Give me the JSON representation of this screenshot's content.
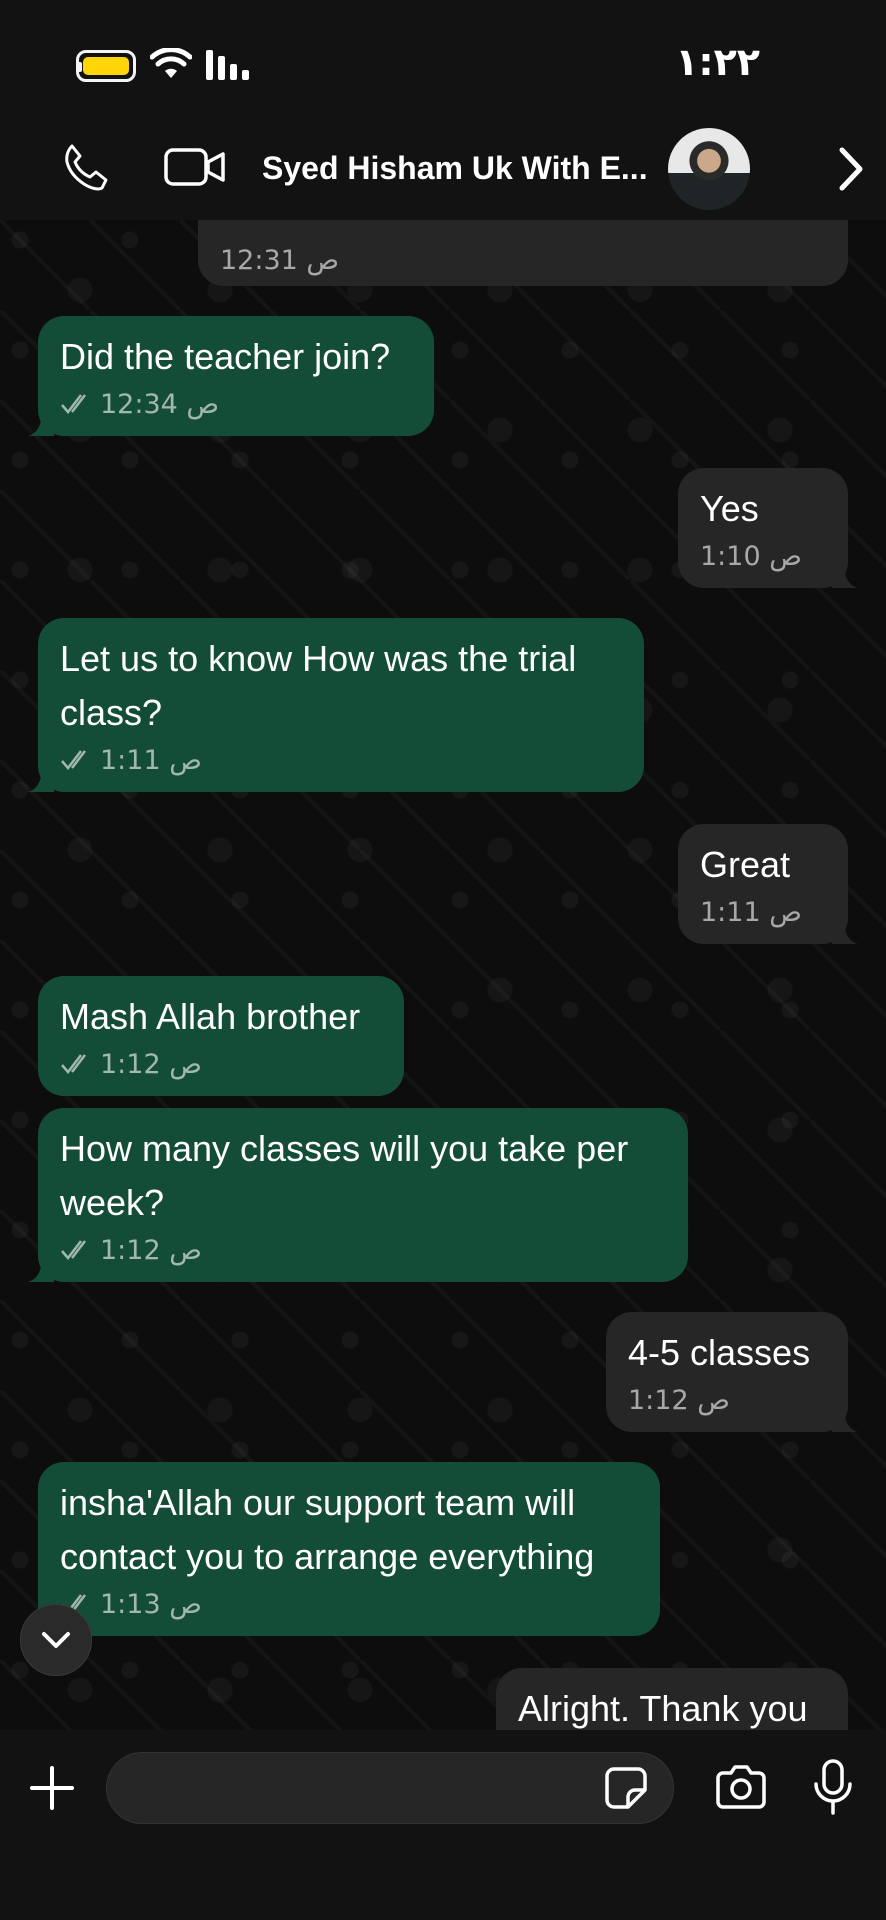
{
  "status_bar": {
    "time": "١:٢٢"
  },
  "header": {
    "contact_name": "Syed Hisham Uk With E..."
  },
  "messages": [
    {
      "direction": "in",
      "text": "",
      "time": "12:31 ص"
    },
    {
      "direction": "out",
      "text": "Did the teacher join?",
      "time": "12:34 ص",
      "read": true
    },
    {
      "direction": "in",
      "text": "Yes",
      "time": "1:10 ص"
    },
    {
      "direction": "out",
      "text": "Let us to know How was the trial class?",
      "time": "1:11 ص",
      "read": true
    },
    {
      "direction": "in",
      "text": "Great",
      "time": "1:11 ص"
    },
    {
      "direction": "out",
      "text": "Mash Allah brother",
      "time": "1:12 ص",
      "read": true
    },
    {
      "direction": "out",
      "text": "How many classes will you take per week?",
      "time": "1:12 ص",
      "read": true
    },
    {
      "direction": "in",
      "text": "4-5 classes",
      "time": "1:12 ص"
    },
    {
      "direction": "out",
      "text": "insha'Allah our support team will contact you to arrange everything",
      "time": "1:13 ص",
      "read": true
    },
    {
      "direction": "in",
      "text": "Alright. Thank you",
      "time": ""
    }
  ],
  "composer": {
    "input_value": "",
    "placeholder": ""
  },
  "icons": {
    "call": "phone-icon",
    "video": "video-camera-icon",
    "back": "chevron-right-icon",
    "plus": "plus-icon",
    "sticker": "sticker-icon",
    "camera": "camera-icon",
    "mic": "microphone-icon",
    "scroll": "chevron-down-icon",
    "ticks": "double-check-icon"
  },
  "colors": {
    "outgoing_bubble": "#144d37",
    "incoming_bubble": "#262626",
    "battery": "#ffd60a"
  }
}
